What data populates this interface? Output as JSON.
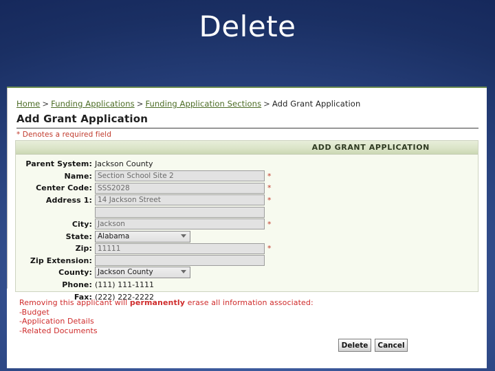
{
  "slide": {
    "title": "Delete"
  },
  "screenshot": {
    "breadcrumb": {
      "items": [
        {
          "label": "Home",
          "link": true
        },
        {
          "label": "Funding Applications",
          "link": true
        },
        {
          "label": "Funding Application Sections",
          "link": true
        },
        {
          "label": "Add Grant Application",
          "link": false
        }
      ],
      "separator": ">"
    },
    "page_title": "Add Grant Application",
    "required_note": "* Denotes a required field",
    "panel": {
      "header": "ADD GRANT APPLICATION",
      "fields": [
        {
          "label": "Parent System:",
          "type": "static",
          "value": "Jackson County",
          "required": false
        },
        {
          "label": "Name:",
          "type": "input",
          "value": "Section School Site 2",
          "required": true
        },
        {
          "label": "Center Code:",
          "type": "input",
          "value": "SSS2028",
          "required": true
        },
        {
          "label": "Address 1:",
          "type": "input",
          "value": "14 Jackson Street",
          "required": true
        },
        {
          "label": "",
          "type": "input",
          "value": "",
          "required": false
        },
        {
          "label": "City:",
          "type": "input",
          "value": "Jackson",
          "required": true
        },
        {
          "label": "State:",
          "type": "select",
          "value": "Alabama",
          "required": false
        },
        {
          "label": "Zip:",
          "type": "input",
          "value": "11111",
          "required": true
        },
        {
          "label": "Zip Extension:",
          "type": "input",
          "value": "",
          "required": false
        },
        {
          "label": "County:",
          "type": "select",
          "value": "Jackson County",
          "required": false
        },
        {
          "label": "Phone:",
          "type": "static",
          "value": "(111) 111-1111",
          "required": false
        },
        {
          "label": "Fax:",
          "type": "static",
          "value": "(222) 222-2222",
          "required": false
        }
      ]
    },
    "warning": {
      "lead_before": "Removing this applicant will ",
      "lead_bold": "permanently",
      "lead_after": " erase all information associated:",
      "items": [
        "-Budget",
        "-Application Details",
        "-Related Documents"
      ]
    },
    "buttons": [
      {
        "label": "Delete",
        "name": "delete-button"
      },
      {
        "label": "Cancel",
        "name": "cancel-button"
      }
    ]
  },
  "colors": {
    "accent_green": "#6f8f52",
    "warning_red": "#cf2b2b",
    "link_green": "#4a6b23",
    "panel_bg": "#f7faef"
  }
}
